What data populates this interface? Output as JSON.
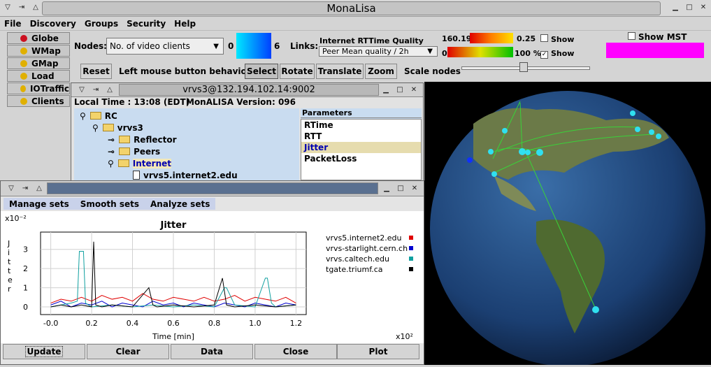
{
  "app": {
    "title": "MonaLisa"
  },
  "menu": [
    "File",
    "Discovery",
    "Groups",
    "Security",
    "Help"
  ],
  "sidebar": [
    {
      "label": "Globe",
      "color": "#cc1020"
    },
    {
      "label": "WMap",
      "color": "#e0b000"
    },
    {
      "label": "GMap",
      "color": "#e0b000"
    },
    {
      "label": "Load",
      "color": "#e0b000"
    },
    {
      "label": "IOTraffic",
      "color": "#e0b000"
    },
    {
      "label": "Clients",
      "color": "#e0b000"
    }
  ],
  "nodes": {
    "label": "Nodes:",
    "select": "No. of video clients",
    "min": "0",
    "max": "6"
  },
  "links": {
    "label": "Links:",
    "title": "Internet RTTime Quality",
    "select": "Peer Mean quality / 2h",
    "scale1_left": "160.19",
    "scale1_right": "0.25",
    "scale2_left": "0",
    "scale2_right": "100 %",
    "show1": "Show",
    "show2": "Show"
  },
  "mst": {
    "label": "Show MST",
    "color": "#ff00ff"
  },
  "toolbar": {
    "reset": "Reset",
    "behavior": "Left mouse button behavior:",
    "select": "Select",
    "rotate": "Rotate",
    "translate": "Translate",
    "zoom": "Zoom",
    "scale": "Scale nodes",
    "scale_value": 0.3
  },
  "node_window": {
    "title": "vrvs3@132.194.102.14:9002",
    "local_time": "Local Time : 13:08 (EDT)",
    "version": "MonALISA Version: 096",
    "tree": [
      "RC",
      "vrvs3",
      "Reflector",
      "Peers",
      "Internet",
      "vrvs5.internet2.edu"
    ],
    "params_header": "Parameters",
    "params": [
      "RTime",
      "RTT",
      "Jitter",
      "PacketLoss"
    ],
    "selected_param": "Jitter"
  },
  "plot_window": {
    "tabs": [
      "Manage sets",
      "Smooth sets",
      "Analyze sets"
    ],
    "buttons": [
      "Update",
      "Clear",
      "Data",
      "Close",
      "Plot"
    ]
  },
  "chart_data": {
    "type": "line",
    "title": "Jitter",
    "xlabel": "Time [min]",
    "ylabel": "Jitter",
    "x_multiplier": "x10²",
    "y_multiplier": "x10⁻²",
    "xlim": [
      -0.05,
      1.25
    ],
    "ylim": [
      -0.4,
      3.9
    ],
    "x_ticks": [
      "-0.0",
      "0.2",
      "0.4",
      "0.6",
      "0.8",
      "1.0",
      "1.2"
    ],
    "y_ticks": [
      "3",
      "2",
      "1",
      "0"
    ],
    "series": [
      {
        "name": "vrvs5.internet2.edu",
        "color": "#e00000",
        "x": [
          0.0,
          0.05,
          0.1,
          0.15,
          0.2,
          0.25,
          0.3,
          0.35,
          0.4,
          0.45,
          0.5,
          0.55,
          0.6,
          0.65,
          0.7,
          0.75,
          0.8,
          0.85,
          0.9,
          0.95,
          1.0,
          1.05,
          1.1,
          1.15,
          1.2
        ],
        "y": [
          0.2,
          0.4,
          0.3,
          0.5,
          0.3,
          0.6,
          0.4,
          0.5,
          0.3,
          0.7,
          0.4,
          0.3,
          0.5,
          0.4,
          0.3,
          0.5,
          0.3,
          0.4,
          0.6,
          0.3,
          0.5,
          0.4,
          0.3,
          0.5,
          0.2
        ]
      },
      {
        "name": "vrvs-starlight.cern.ch",
        "color": "#0000d0",
        "x": [
          0.0,
          0.05,
          0.1,
          0.15,
          0.2,
          0.25,
          0.3,
          0.35,
          0.4,
          0.45,
          0.5,
          0.55,
          0.6,
          0.65,
          0.7,
          0.75,
          0.8,
          0.85,
          0.9,
          0.95,
          1.0,
          1.05,
          1.1,
          1.15,
          1.2
        ],
        "y": [
          0.1,
          0.3,
          0.0,
          0.2,
          0.1,
          0.3,
          0.0,
          0.2,
          0.1,
          0.0,
          0.3,
          0.1,
          0.2,
          0.0,
          0.2,
          0.1,
          0.0,
          0.2,
          0.1,
          0.0,
          0.2,
          0.1,
          0.0,
          0.2,
          0.1
        ]
      },
      {
        "name": "vrvs.caltech.edu",
        "color": "#10a0a0",
        "x": [
          0.0,
          0.05,
          0.1,
          0.13,
          0.14,
          0.16,
          0.17,
          0.2,
          0.3,
          0.4,
          0.5,
          0.6,
          0.7,
          0.8,
          0.85,
          0.86,
          0.9,
          1.0,
          1.05,
          1.06,
          1.08,
          1.1,
          1.2
        ],
        "y": [
          0.0,
          0.1,
          0.2,
          0.3,
          2.9,
          2.9,
          0.2,
          0.0,
          0.1,
          0.0,
          0.1,
          0.0,
          0.1,
          0.0,
          1.0,
          1.0,
          0.1,
          0.0,
          1.5,
          1.5,
          0.2,
          0.0,
          0.1
        ]
      },
      {
        "name": "tgate.triumf.ca",
        "color": "#000000",
        "x": [
          0.0,
          0.05,
          0.1,
          0.15,
          0.2,
          0.21,
          0.22,
          0.25,
          0.3,
          0.4,
          0.48,
          0.5,
          0.52,
          0.6,
          0.7,
          0.8,
          0.84,
          0.86,
          0.9,
          1.0,
          1.1,
          1.2
        ],
        "y": [
          0.0,
          0.1,
          0.0,
          0.1,
          0.0,
          3.4,
          0.1,
          0.0,
          0.1,
          0.0,
          1.0,
          0.1,
          0.0,
          0.1,
          0.0,
          0.1,
          1.5,
          0.1,
          0.0,
          0.1,
          0.0,
          0.1
        ]
      }
    ]
  }
}
